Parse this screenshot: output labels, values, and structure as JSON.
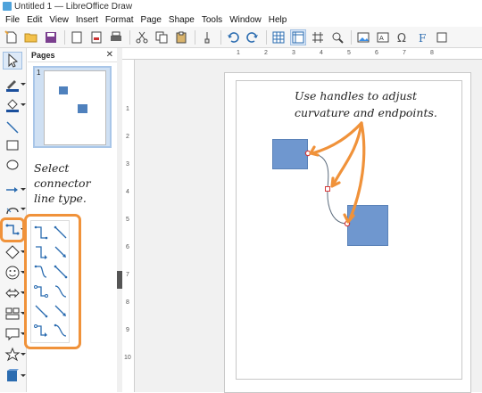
{
  "window": {
    "title": "Untitled 1 — LibreOffice Draw"
  },
  "menu": {
    "items": [
      "File",
      "Edit",
      "View",
      "Insert",
      "Format",
      "Page",
      "Shape",
      "Tools",
      "Window",
      "Help"
    ]
  },
  "pages_panel": {
    "title": "Pages",
    "page_number": "1"
  },
  "annotations": {
    "left_note_line1": "Select",
    "left_note_line2": "connector",
    "left_note_line3": "line type.",
    "top_note_line1": "Use handles to adjust",
    "top_note_line2": "curvature and endpoints."
  },
  "ruler": {
    "h_ticks": [
      "1",
      "2",
      "3",
      "4",
      "5",
      "6",
      "7",
      "8"
    ],
    "v_ticks": [
      "1",
      "2",
      "3",
      "4",
      "5",
      "6",
      "7",
      "8",
      "9",
      "10"
    ]
  },
  "colors": {
    "accent_orange": "#f0923a",
    "shape_fill": "#6f97cf",
    "handle_red": "#d63a3a"
  }
}
